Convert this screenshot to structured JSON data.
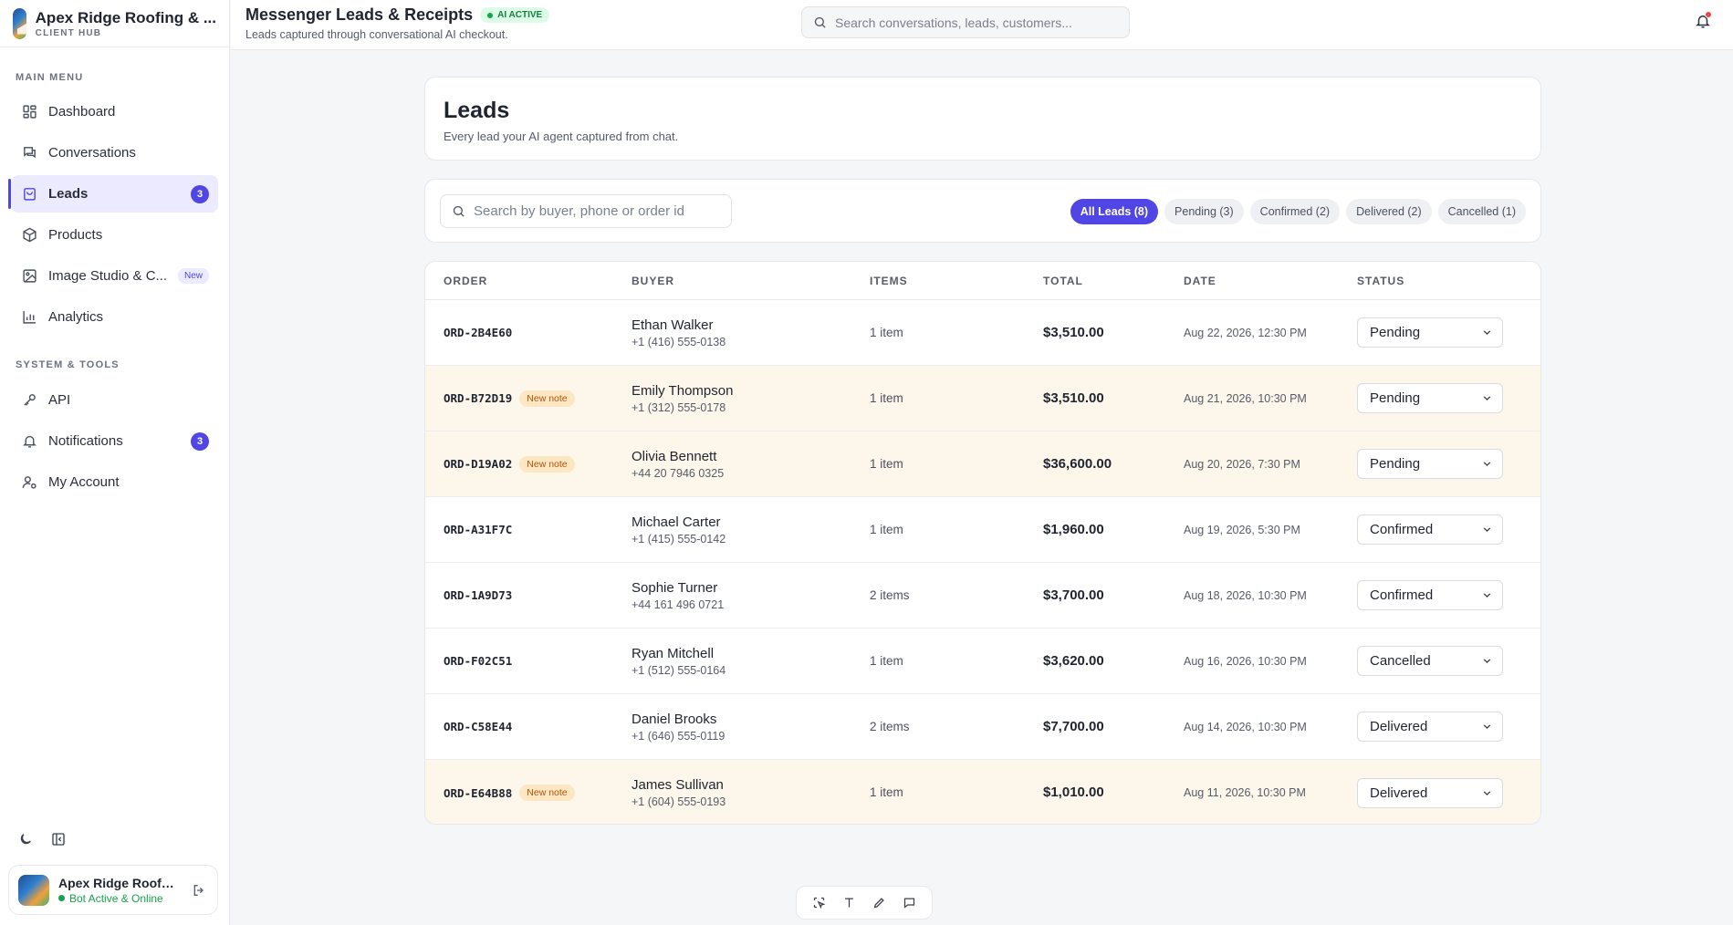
{
  "brand": {
    "name": "Apex Ridge Roofing & ...",
    "sub": "CLIENT HUB"
  },
  "sidebar": {
    "main_label": "MAIN MENU",
    "main_items": [
      {
        "label": "Dashboard",
        "icon": "grid-icon"
      },
      {
        "label": "Conversations",
        "icon": "chat-icon"
      },
      {
        "label": "Leads",
        "icon": "bag-icon",
        "badge": "3",
        "active": true
      },
      {
        "label": "Products",
        "icon": "box-icon"
      },
      {
        "label": "Image Studio & C...",
        "icon": "image-icon",
        "badge_new": "New"
      },
      {
        "label": "Analytics",
        "icon": "bar-chart-icon"
      }
    ],
    "tools_label": "SYSTEM & TOOLS",
    "tools_items": [
      {
        "label": "API",
        "icon": "key-icon"
      },
      {
        "label": "Notifications",
        "icon": "bell-icon",
        "badge": "3"
      },
      {
        "label": "My Account",
        "icon": "user-gear-icon"
      }
    ]
  },
  "account": {
    "name": "Apex Ridge Roofin...",
    "status": "Bot Active & Online"
  },
  "header": {
    "title": "Messenger Leads & Receipts",
    "pill": "AI ACTIVE",
    "subtitle": "Leads captured through conversational AI checkout.",
    "search_placeholder": "Search conversations, leads, customers..."
  },
  "page": {
    "title": "Leads",
    "subtitle": "Every lead your AI agent captured from chat."
  },
  "filters": {
    "search_placeholder": "Search by buyer, phone or order id",
    "tabs": [
      "All Leads (8)",
      "Pending (3)",
      "Confirmed (2)",
      "Delivered (2)",
      "Cancelled (1)"
    ]
  },
  "table": {
    "columns": [
      "ORDER",
      "BUYER",
      "ITEMS",
      "TOTAL",
      "DATE",
      "STATUS"
    ],
    "note_label": "New note",
    "rows": [
      {
        "order": "ORD-2B4E60",
        "note": false,
        "name": "Ethan Walker",
        "phone": "+1 (416) 555-0138",
        "items": "1 item",
        "total": "$3,510.00",
        "date": "Aug 22, 2026, 12:30 PM",
        "status": "Pending"
      },
      {
        "order": "ORD-B72D19",
        "note": true,
        "name": "Emily Thompson",
        "phone": "+1 (312) 555-0178",
        "items": "1 item",
        "total": "$3,510.00",
        "date": "Aug 21, 2026, 10:30 PM",
        "status": "Pending"
      },
      {
        "order": "ORD-D19A02",
        "note": true,
        "name": "Olivia Bennett",
        "phone": "+44 20 7946 0325",
        "items": "1 item",
        "total": "$36,600.00",
        "date": "Aug 20, 2026, 7:30 PM",
        "status": "Pending"
      },
      {
        "order": "ORD-A31F7C",
        "note": false,
        "name": "Michael Carter",
        "phone": "+1 (415) 555-0142",
        "items": "1 item",
        "total": "$1,960.00",
        "date": "Aug 19, 2026, 5:30 PM",
        "status": "Confirmed"
      },
      {
        "order": "ORD-1A9D73",
        "note": false,
        "name": "Sophie Turner",
        "phone": "+44 161 496 0721",
        "items": "2 items",
        "total": "$3,700.00",
        "date": "Aug 18, 2026, 10:30 PM",
        "status": "Confirmed"
      },
      {
        "order": "ORD-F02C51",
        "note": false,
        "name": "Ryan Mitchell",
        "phone": "+1 (512) 555-0164",
        "items": "1 item",
        "total": "$3,620.00",
        "date": "Aug 16, 2026, 10:30 PM",
        "status": "Cancelled"
      },
      {
        "order": "ORD-C58E44",
        "note": false,
        "name": "Daniel Brooks",
        "phone": "+1 (646) 555-0119",
        "items": "2 items",
        "total": "$7,700.00",
        "date": "Aug 14, 2026, 10:30 PM",
        "status": "Delivered"
      },
      {
        "order": "ORD-E64B88",
        "note": true,
        "name": "James Sullivan",
        "phone": "+1 (604) 555-0193",
        "items": "1 item",
        "total": "$1,010.00",
        "date": "Aug 11, 2026, 10:30 PM",
        "status": "Delivered"
      }
    ]
  },
  "colors": {
    "accent": "#4f46e5",
    "note_row": "#fdf6ea",
    "online": "#16a34a"
  }
}
